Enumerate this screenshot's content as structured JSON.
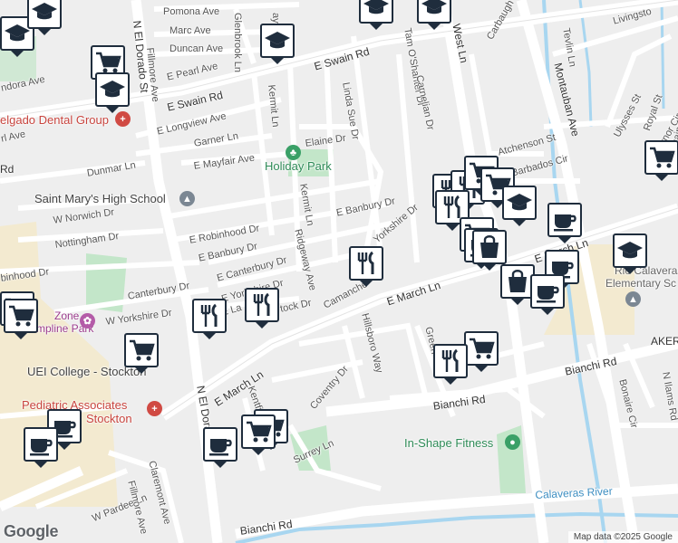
{
  "streets": {
    "pomona_ave": "Pomona Ave",
    "marc_ave": "Marc Ave",
    "duncan_ave": "Duncan Ave",
    "glenbrook_ln": "Glenbrook Ln",
    "haywood_ln": "aywood Ln",
    "e_swain_rd_top": "E Swain Rd",
    "e_swain_rd_left": "E Swain Rd",
    "e_pearl_ave": "E Pearl Ave",
    "fillmore_ave": "Fillmore Ave",
    "n_el_dorado_st_top": "N El Dorado St",
    "n_el_dorado_st_bottom": "N El Dorado St",
    "dora_ave": "ndora Ave",
    "e_longview_ave": "E Longview Ave",
    "garner_ln": "Garner Ln",
    "e_mayfair_ave": "E Mayfair Ave",
    "elaine_dr": "Elaine Dr",
    "kermit_ln_top": "Kermit Ln",
    "kermit_ln_mid": "Kermit Ln",
    "linda_sue_dr": "Linda Sue Dr",
    "tam_oshanter_dr": "Tam O'Shanter Dr",
    "carnelian_dr": "Carnelian Dr",
    "west_ln": "West Ln",
    "carbaugh_cir": "Carbaugh Cir",
    "montauban_ave": "Montauban Ave",
    "teviin_ln": "Tevlin Ln",
    "livingston": "Livingsto",
    "ulysses_st": "Ulysses St",
    "royal_st": "Royal St",
    "governor_cir": "Governor Cir",
    "lorraine_ave": "Lorraine Ave",
    "atchenson_st": "Atchenson St",
    "barbados_cir": "Barbados Cir",
    "rl_ave": "rl Ave",
    "rd_left": "Rd",
    "dunmar_ln": "Dunmar Ln",
    "w_norwich_dr": "W Norwich Dr",
    "nottingham_dr": "Nottingham Dr",
    "e_robinhood_dr": "E Robinhood Dr",
    "e_banbury_dr_w": "E Banbury Dr",
    "e_banbury_dr_e": "E Banbury Dr",
    "e_canterbury_dr": "E Canterbury Dr",
    "ridgeway_ave": "Ridgeway Ave",
    "e_yorkshire_dr_w": "E Yorkshire Dr",
    "e_yorkshire_dr_e": "Yorkshire Dr",
    "canterbury_dr": "Canterbury Dr",
    "robinhood_dr": "binhood Dr",
    "w_yorkshire_dr": "W Yorkshire Dr",
    "e_la_dr": "E La",
    "stock_dr": "tock Dr",
    "camanche": "Camanche",
    "e_march_ln_mid": "E March Ln",
    "e_march_ln_right": "E March Ln",
    "e_march_ln_left": "E March Ln",
    "hillsboro_way": "Hillsboro Way",
    "green_way": "Green Way",
    "bianchi_rd_mid": "Bianchi Rd",
    "bianchi_rd_right": "Bianchi Rd",
    "bianchi_rd_bottom": "Bianchi Rd",
    "coventry_dr": "Coventry Dr",
    "kentfield": "Kentfie",
    "surrey_ln": "Surrey Ln",
    "claremont_ave": "Claremont Ave",
    "w_pardee_ln": "W Pardee Ln",
    "fillmore_ave_bottom": "Fillmore Ave",
    "bonaire_cir": "Bonaire Cir",
    "n_ilams_rd": "N Ilams Rd",
    "akers": "AKER",
    "calaveras_river": "Calaveras River"
  },
  "places": {
    "delgado_dental": "elgado Dental Group",
    "holiday_park": "Holiday Park",
    "saint_marys": "Saint Mary's High School",
    "uei_college": "UEI College - Stockton",
    "pediatric_associates_1": "Pediatric Associates",
    "pediatric_associates_2": "Stockton",
    "zone_1": "Zone",
    "zone_2": "mpline Park",
    "in_shape_fitness": "In-Shape Fitness",
    "rio_calaveras_1": "Rio Calaveras",
    "rio_calaveras_2": "Elementary Sc"
  },
  "footer": {
    "attribution": "Map data ©2025 Google",
    "logo": "Google"
  },
  "colors": {
    "land": "#eeeeee",
    "road_major": "#ffffff",
    "park": "#c3e6c9",
    "water": "#a8d6f0",
    "school_area": "#f5ecd2",
    "pin_border": "#1f2d3d"
  },
  "markers": [
    {
      "type": "school",
      "label": "school-icon"
    },
    {
      "type": "grocery",
      "label": "grocery-cart-icon"
    },
    {
      "type": "restaurant",
      "label": "restaurant-icon"
    },
    {
      "type": "cafe",
      "label": "coffee-cup-icon"
    },
    {
      "type": "shopping",
      "label": "shopping-bag-icon"
    }
  ]
}
